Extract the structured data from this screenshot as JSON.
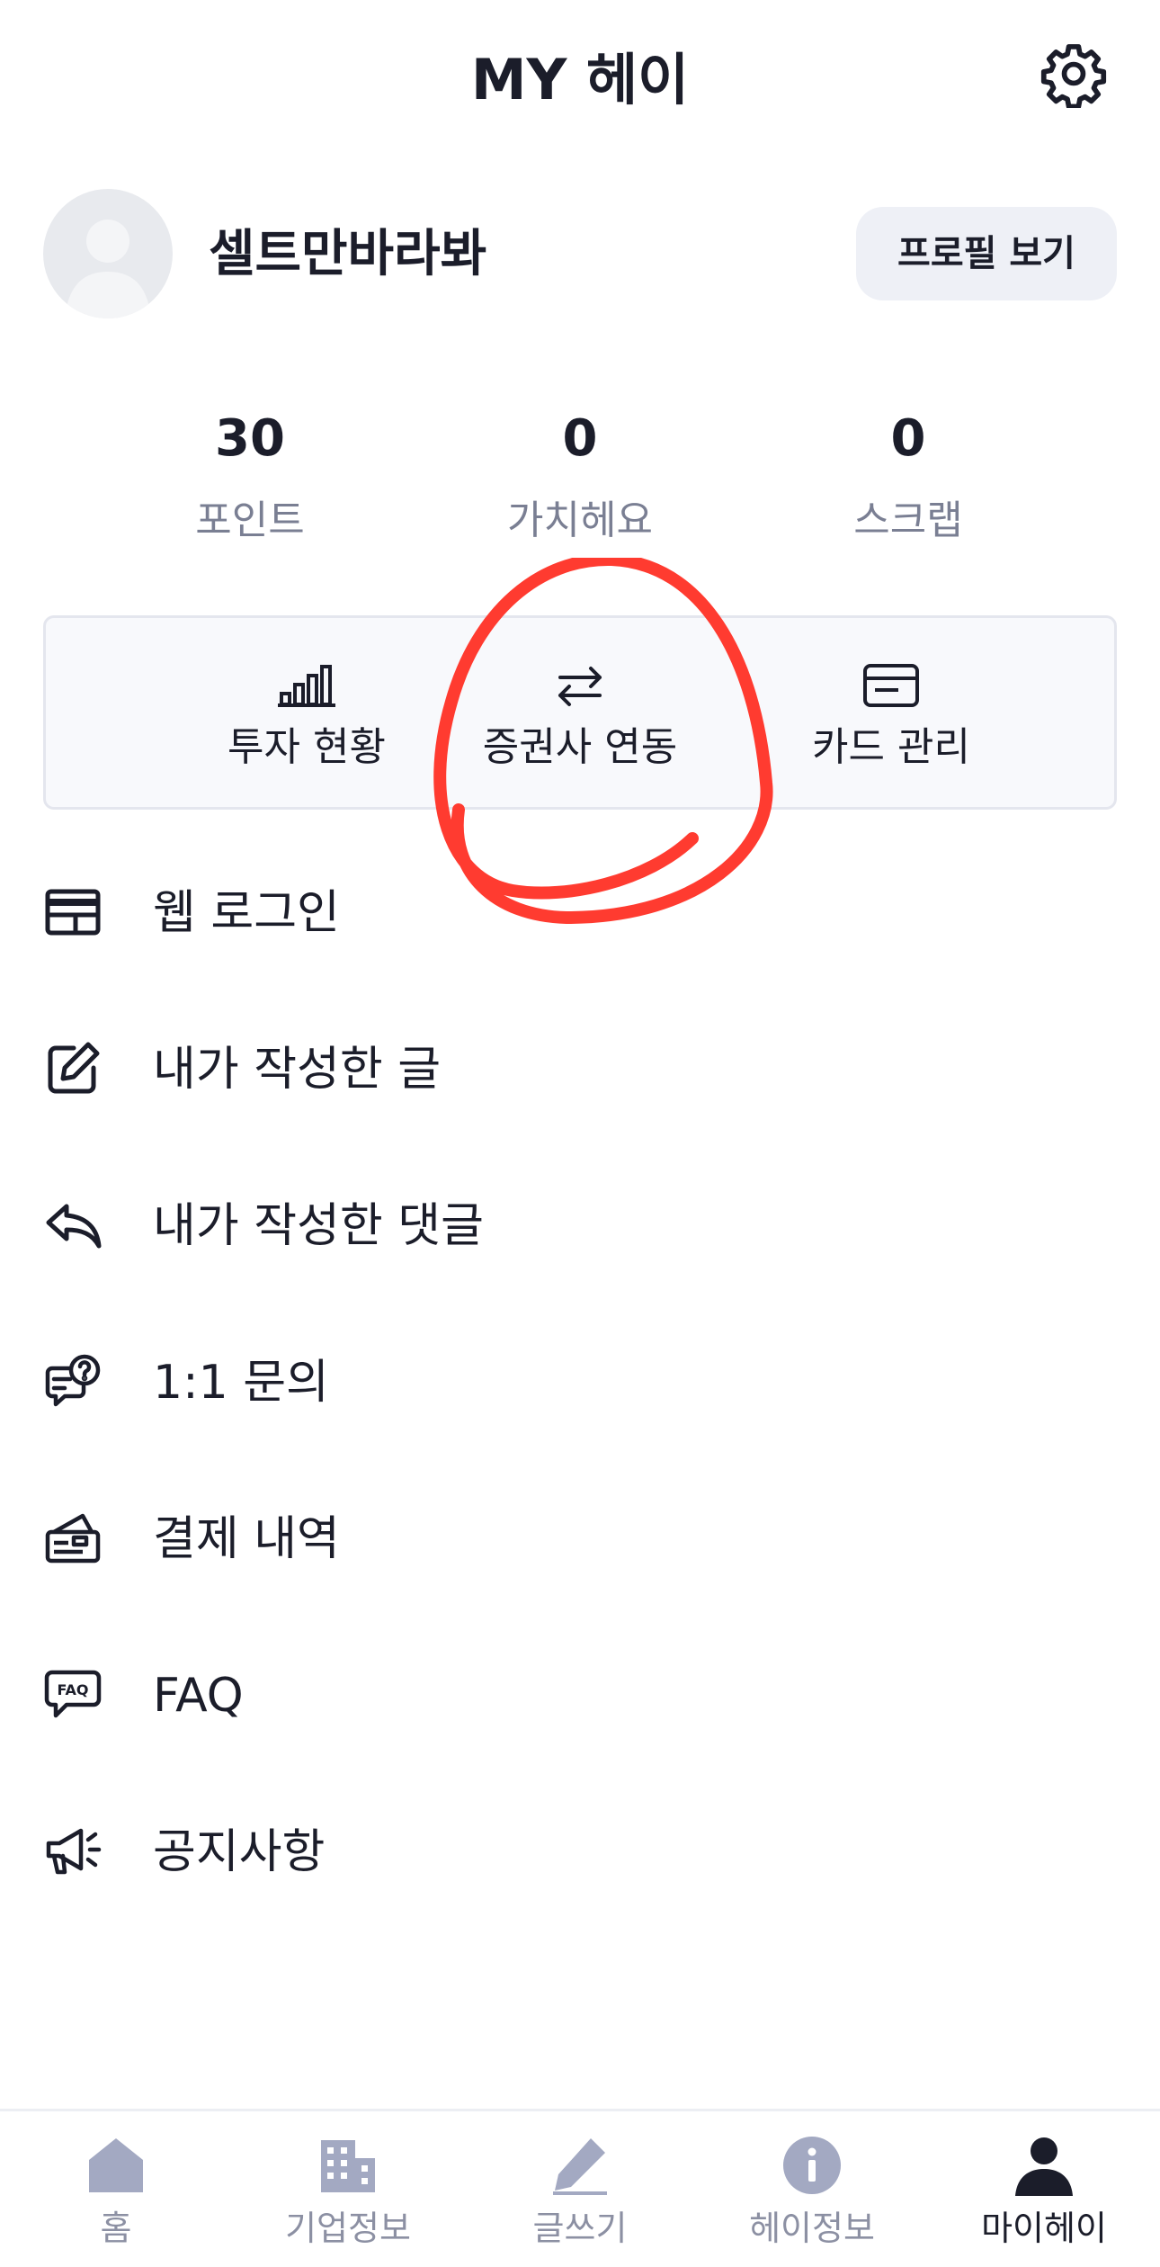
{
  "header": {
    "title": "MY 헤이",
    "settings_icon": "gear-icon"
  },
  "profile": {
    "nickname": "셀트만바라봐",
    "view_button": "프로필 보기"
  },
  "stats": [
    {
      "value": "30",
      "label": "포인트"
    },
    {
      "value": "0",
      "label": "가치헤요"
    },
    {
      "value": "0",
      "label": "스크랩"
    }
  ],
  "quick_actions": [
    {
      "label": "투자 현황",
      "icon": "bar-chart-icon"
    },
    {
      "label": "증권사 연동",
      "icon": "swap-arrows-icon"
    },
    {
      "label": "카드 관리",
      "icon": "credit-card-icon"
    }
  ],
  "menu": [
    {
      "label": "웹 로그인",
      "icon": "browser-window-icon"
    },
    {
      "label": "내가 작성한 글",
      "icon": "edit-icon"
    },
    {
      "label": "내가 작성한 댓글",
      "icon": "reply-icon"
    },
    {
      "label": "1:1 문의",
      "icon": "question-chat-icon"
    },
    {
      "label": "결제 내역",
      "icon": "wallet-icon"
    },
    {
      "label": "FAQ",
      "icon": "faq-bubble-icon"
    },
    {
      "label": "공지사항",
      "icon": "megaphone-icon"
    }
  ],
  "tabbar": [
    {
      "label": "홈",
      "icon": "home-icon",
      "active": false
    },
    {
      "label": "기업정보",
      "icon": "building-icon",
      "active": false
    },
    {
      "label": "글쓰기",
      "icon": "pencil-icon",
      "active": false
    },
    {
      "label": "헤이정보",
      "icon": "info-icon",
      "active": false
    },
    {
      "label": "마이헤이",
      "icon": "person-icon",
      "active": true
    }
  ],
  "colors": {
    "text": "#1b1d2a",
    "muted": "#7a7f93",
    "tab_inactive": "#a3a9c2",
    "button_bg": "#eef0f6",
    "annotation": "#ff3b30"
  }
}
